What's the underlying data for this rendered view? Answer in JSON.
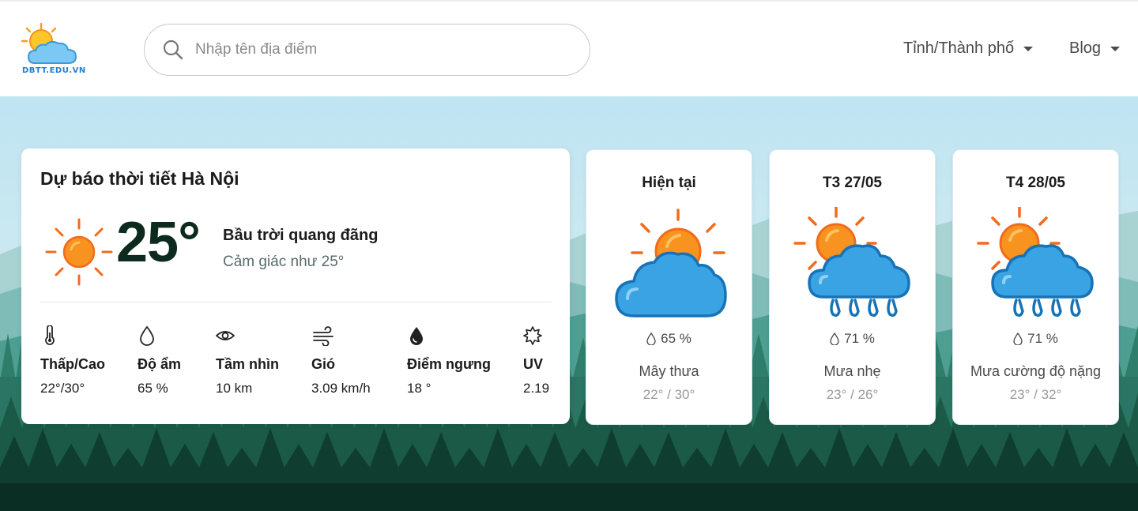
{
  "header": {
    "logo_text": "DBTT.EDU.VN",
    "search_placeholder": "Nhập tên địa điểm",
    "nav": [
      {
        "label": "Tỉnh/Thành phố"
      },
      {
        "label": "Blog"
      }
    ]
  },
  "current": {
    "title": "Dự báo thời tiết Hà Nội",
    "temperature": "25°",
    "condition": "Bầu trời quang đãng",
    "feels_like": "Cảm giác như 25°",
    "icon": "sun-icon",
    "stats": [
      {
        "icon": "thermometer-icon",
        "label": "Thấp/Cao",
        "value": "22°/30°"
      },
      {
        "icon": "humidity-icon",
        "label": "Độ ẩm",
        "value": "65 %"
      },
      {
        "icon": "eye-icon",
        "label": "Tầm nhìn",
        "value": "10 km"
      },
      {
        "icon": "wind-icon",
        "label": "Gió",
        "value": "3.09 km/h"
      },
      {
        "icon": "dew-point-icon",
        "label": "Điểm ngưng",
        "value": "18 °"
      },
      {
        "icon": "uv-icon",
        "label": "UV",
        "value": "2.19"
      }
    ]
  },
  "forecast": [
    {
      "title": "Hiện tại",
      "icon": "sun-cloud-icon",
      "humidity": "65 %",
      "description": "Mây thưa",
      "range": "22° / 30°"
    },
    {
      "title": "T3 27/05",
      "icon": "sun-rain-icon",
      "humidity": "71 %",
      "description": "Mưa nhẹ",
      "range": "23° / 26°"
    },
    {
      "title": "T4 28/05",
      "icon": "sun-rain-icon",
      "humidity": "71 %",
      "description": "Mưa cường độ nặng",
      "range": "23° / 32°"
    }
  ],
  "colors": {
    "sky": "#bfe3f0",
    "forest_dark": "#0e3a2c",
    "sun_orange": "#f7931e",
    "cloud_blue": "#3aa3e3"
  }
}
